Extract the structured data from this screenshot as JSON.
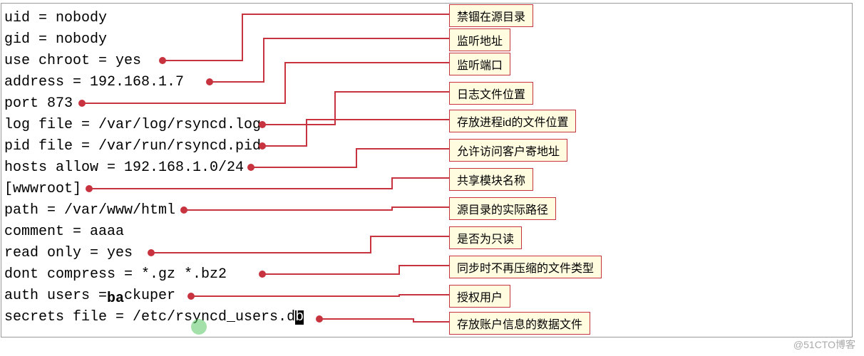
{
  "config": {
    "uid": "uid = nobody",
    "gid": "gid = nobody",
    "use_chroot": "use chroot = yes",
    "address": "address = 192.168.1.7",
    "port": "port 873",
    "log_file": "log file = /var/log/rsyncd.log",
    "pid_file": "pid file = /var/run/rsyncd.pid",
    "hosts_allow": "hosts allow = 192.168.1.0/24",
    "module": "[wwwroot]",
    "path": "path = /var/www/html",
    "comment": "comment = aaaa",
    "read_only": "read only = yes",
    "dont_compress": "dont compress = *.gz *.bz2",
    "auth_users_a": "auth users =",
    "auth_users_b": "ckuper",
    "auth_users_mid": "ba",
    "secrets_a": "secrets file = /etc/rsyncd_users.d",
    "secrets_b": "b"
  },
  "callouts": {
    "chroot": "禁锢在源目录",
    "address": "监听地址",
    "port": "监听端口",
    "log_file": "日志文件位置",
    "pid_file": "存放进程id的文件位置",
    "hosts_allow": "允许访问客户寄地址",
    "module": "共享模块名称",
    "path": "源目录的实际路径",
    "read_only": "是否为只读",
    "dont_compress": "同步时不再压缩的文件类型",
    "auth_users": "授权用户",
    "secrets": "存放账户信息的数据文件"
  },
  "watermark": "@51CTO博客"
}
